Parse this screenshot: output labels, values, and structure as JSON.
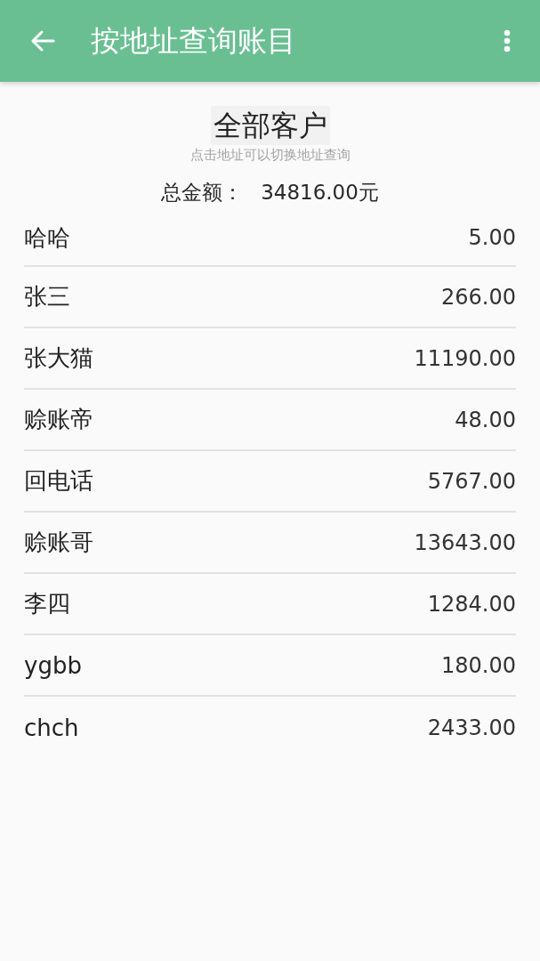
{
  "app_bar": {
    "title": "按地址查询账目"
  },
  "filter": {
    "label": "全部客户",
    "hint": "点击地址可以切换地址查询"
  },
  "total": {
    "label": "总金额：",
    "value": "34816.00元"
  },
  "customers": [
    {
      "name": "哈哈",
      "amount": "5.00"
    },
    {
      "name": "张三",
      "amount": "266.00"
    },
    {
      "name": "张大猫",
      "amount": "11190.00"
    },
    {
      "name": "赊账帝",
      "amount": "48.00"
    },
    {
      "name": "回电话",
      "amount": "5767.00"
    },
    {
      "name": "赊账哥",
      "amount": "13643.00"
    },
    {
      "name": "李四",
      "amount": "1284.00"
    },
    {
      "name": "ygbb",
      "amount": "180.00"
    },
    {
      "name": "chch",
      "amount": "2433.00"
    }
  ]
}
